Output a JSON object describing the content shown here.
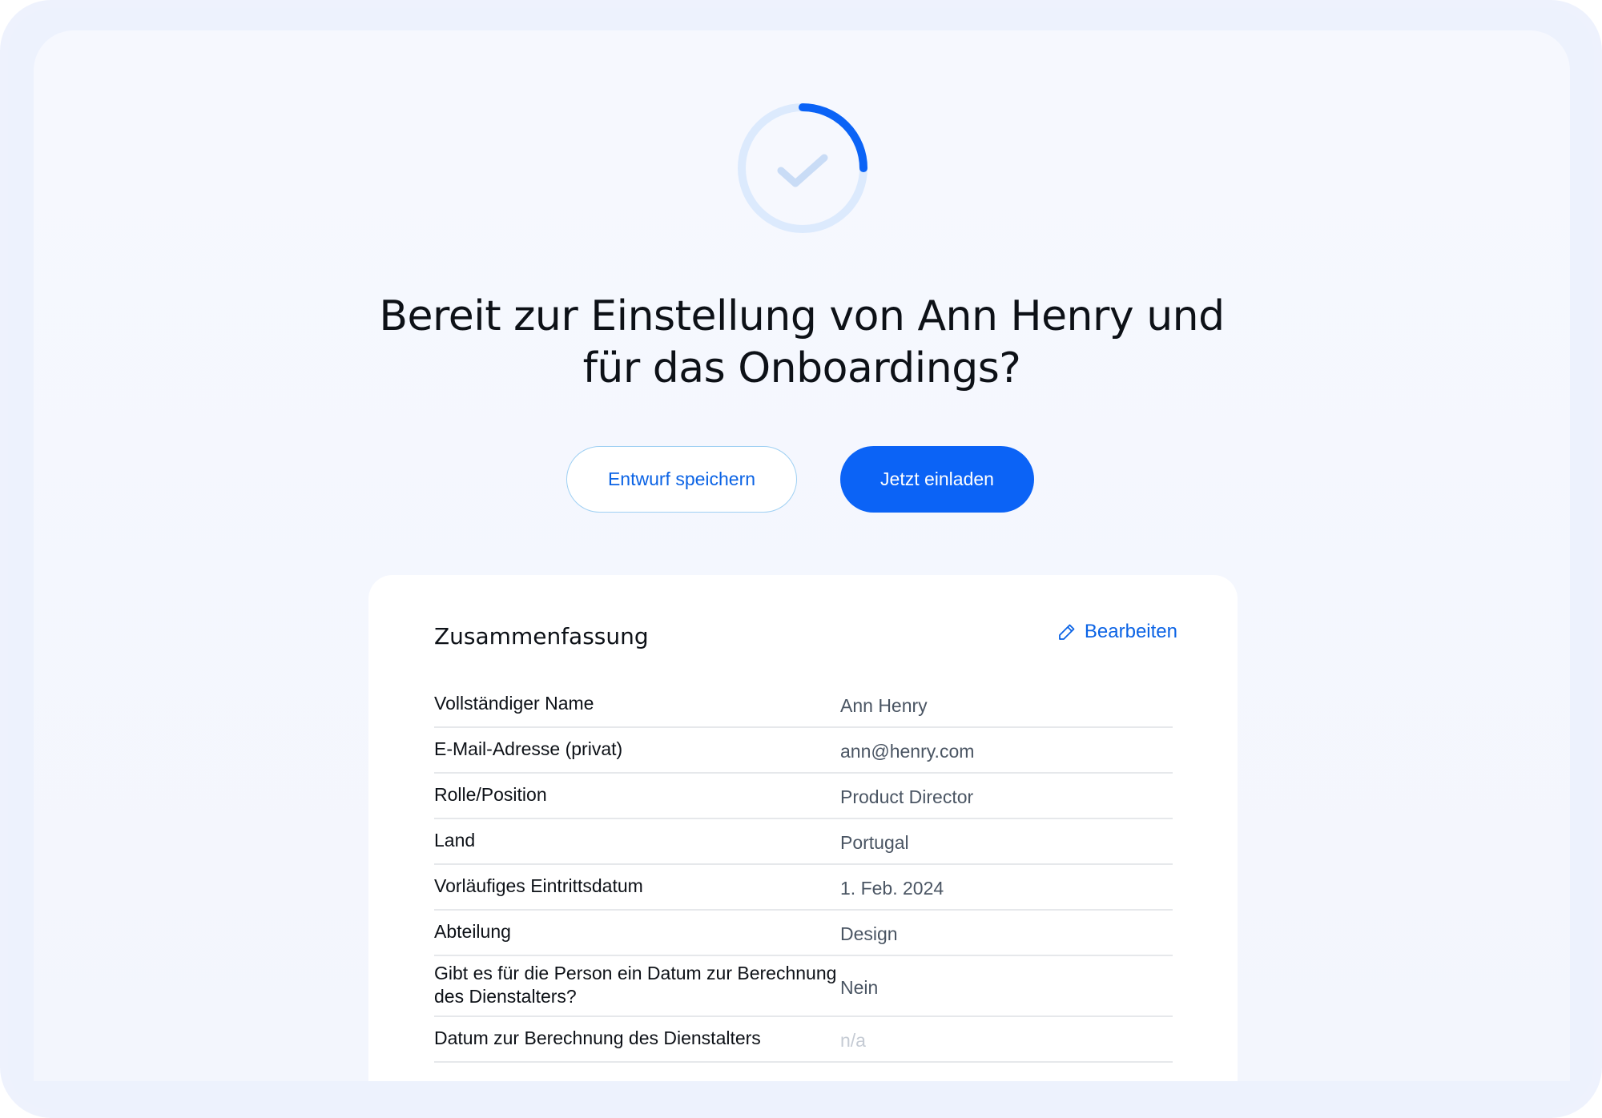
{
  "header": {
    "headline": "Bereit zur Einstellung von Ann Henry und für das Onboardings?",
    "status_icon": "check-icon",
    "progress_fraction": 0.25
  },
  "actions": {
    "save_draft_label": "Entwurf speichern",
    "invite_label": "Jetzt einladen"
  },
  "summary": {
    "title": "Zusammenfassung",
    "edit_label": "Bearbeiten",
    "edit_icon": "pencil-icon",
    "rows": [
      {
        "label": "Vollständiger Name",
        "value": "Ann Henry"
      },
      {
        "label": "E-Mail-Adresse (privat)",
        "value": "ann@henry.com"
      },
      {
        "label": "Rolle/Position",
        "value": "Product Director"
      },
      {
        "label": "Land",
        "value": "Portugal"
      },
      {
        "label": "Vorläufiges Eintrittsdatum",
        "value": "1. Feb. 2024"
      },
      {
        "label": "Abteilung",
        "value": "Design"
      },
      {
        "label": "Gibt es für die Person ein Datum zur Berechnung  des Dienstalters?",
        "value": "Nein"
      },
      {
        "label": "Datum zur Berechnung des Dienstalters",
        "value": "n/a"
      }
    ]
  },
  "colors": {
    "accent": "#0b63f6",
    "ring_track": "#dceafd",
    "ring_progress": "#0b63f6",
    "check": "#c9dcf6"
  }
}
